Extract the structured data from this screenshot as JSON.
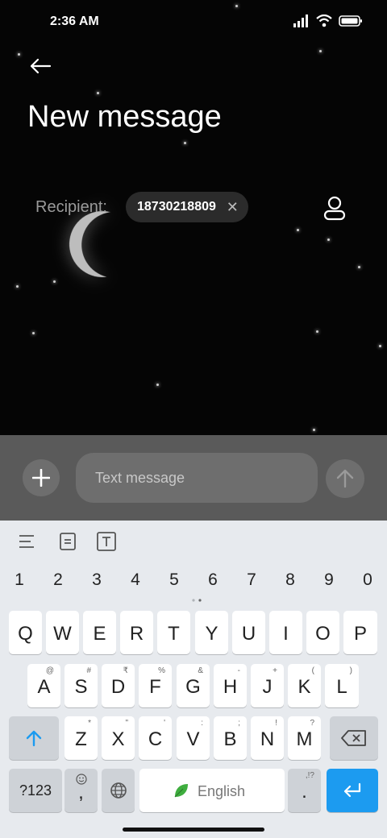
{
  "status_bar": {
    "time": "2:36 AM"
  },
  "header": {
    "title": "New message"
  },
  "recipient": {
    "label": "Recipient:",
    "number": "18730218809",
    "remove_symbol": "✕"
  },
  "compose": {
    "placeholder": "Text message"
  },
  "keyboard": {
    "numbers": [
      "1",
      "2",
      "3",
      "4",
      "5",
      "6",
      "7",
      "8",
      "9",
      "0"
    ],
    "row1": [
      {
        "main": "Q",
        "sub": ""
      },
      {
        "main": "W",
        "sub": ""
      },
      {
        "main": "E",
        "sub": ""
      },
      {
        "main": "R",
        "sub": ""
      },
      {
        "main": "T",
        "sub": ""
      },
      {
        "main": "Y",
        "sub": ""
      },
      {
        "main": "U",
        "sub": ""
      },
      {
        "main": "I",
        "sub": ""
      },
      {
        "main": "O",
        "sub": ""
      },
      {
        "main": "P",
        "sub": ""
      }
    ],
    "row2": [
      {
        "main": "A",
        "sub": "@"
      },
      {
        "main": "S",
        "sub": "#"
      },
      {
        "main": "D",
        "sub": "₹"
      },
      {
        "main": "F",
        "sub": "%"
      },
      {
        "main": "G",
        "sub": "&"
      },
      {
        "main": "H",
        "sub": "-"
      },
      {
        "main": "J",
        "sub": "+"
      },
      {
        "main": "K",
        "sub": "("
      },
      {
        "main": "L",
        "sub": ")"
      }
    ],
    "row3": [
      {
        "main": "Z",
        "sub": "*"
      },
      {
        "main": "X",
        "sub": "\""
      },
      {
        "main": "C",
        "sub": "'"
      },
      {
        "main": "V",
        "sub": ":"
      },
      {
        "main": "B",
        "sub": ";"
      },
      {
        "main": "N",
        "sub": "!"
      },
      {
        "main": "M",
        "sub": "?"
      }
    ],
    "sym_label": "?123",
    "comma": ",",
    "space_label": "English",
    "period": ".",
    "period_sub": ",!?"
  }
}
